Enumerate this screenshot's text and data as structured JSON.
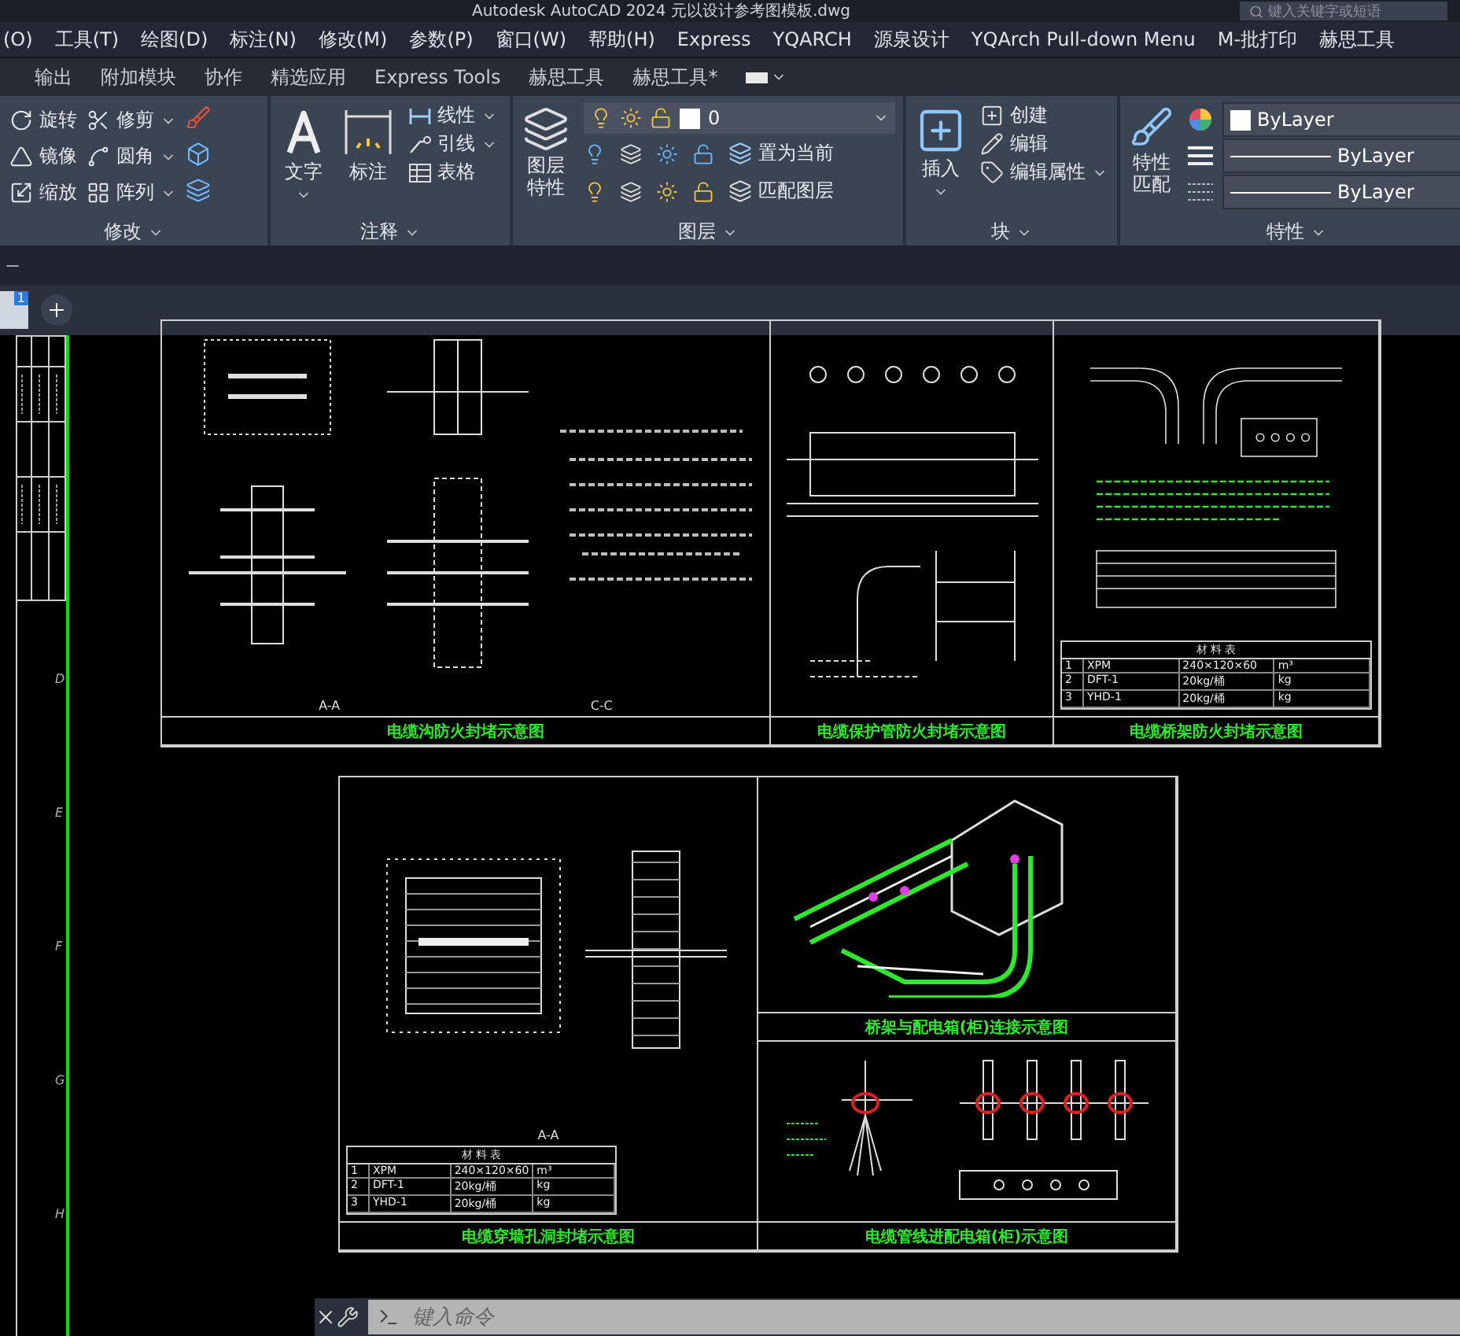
{
  "title_bar": {
    "title": "Autodesk AutoCAD 2024    元以设计参考图模板.dwg",
    "search_placeholder": "键入关键字或短语"
  },
  "menu_bar": [
    "(O)",
    "工具(T)",
    "绘图(D)",
    "标注(N)",
    "修改(M)",
    "参数(P)",
    "窗口(W)",
    "帮助(H)",
    "Express",
    "YQARCH",
    "源泉设计",
    "YQArch Pull-down Menu",
    "M-批打印",
    "赫思工具"
  ],
  "ribbon_tabs": [
    "输出",
    "附加模块",
    "协作",
    "精选应用",
    "Express Tools",
    "赫思工具",
    "赫思工具*"
  ],
  "ribbon_panels": [
    {
      "kind": "modify",
      "title": "修改",
      "tools": [
        {
          "label": "旋转",
          "dropdown": false
        },
        {
          "label": "修剪",
          "dropdown": true
        },
        {
          "label": "镜像",
          "dropdown": false
        },
        {
          "label": "圆角",
          "dropdown": true
        },
        {
          "label": "缩放",
          "dropdown": false
        },
        {
          "label": "阵列",
          "dropdown": true
        }
      ]
    },
    {
      "kind": "annotation",
      "title": "注释",
      "big_tools": [
        {
          "label": "文字",
          "dropdown": true
        },
        {
          "label": "标注",
          "dropdown": false
        }
      ],
      "tools": [
        {
          "label": "线性",
          "dropdown": true
        },
        {
          "label": "引线",
          "dropdown": true
        },
        {
          "label": "表格",
          "dropdown": false
        }
      ]
    },
    {
      "kind": "layers",
      "title": "图层",
      "big_tools": [
        {
          "label": "图层特性",
          "dropdown": false
        }
      ],
      "layer": "0",
      "tools": [
        {
          "label": "置为当前",
          "dropdown": false
        },
        {
          "label": "匹配图层",
          "dropdown": false
        }
      ]
    },
    {
      "kind": "block",
      "title": "块",
      "big_tools": [
        {
          "label": "插入",
          "dropdown": true
        }
      ],
      "tools": [
        {
          "label": "创建",
          "dropdown": false
        },
        {
          "label": "编辑",
          "dropdown": false
        },
        {
          "label": "编辑属性",
          "dropdown": true
        }
      ]
    },
    {
      "kind": "properties",
      "title": "特性",
      "big_tools": [
        {
          "label": "特性匹配",
          "dropdown": false
        }
      ],
      "rows": [
        {
          "kind": "color",
          "value": "ByLayer"
        },
        {
          "kind": "linetype",
          "value": "ByLayer"
        },
        {
          "kind": "lineweight",
          "value": "ByLayer"
        }
      ]
    }
  ],
  "document_tabs": [
    {
      "badge": "1",
      "selected": true
    }
  ],
  "grid_labels": [
    "D",
    "E",
    "F",
    "G",
    "H"
  ],
  "sheets": [
    {
      "cells": [
        {
          "kind": "trench",
          "title": "电缆沟防火封堵示意图",
          "labels": [
            "A-A",
            "C-C"
          ]
        },
        {
          "kind": "conduit",
          "title": "电缆保护管防火封堵示意图"
        },
        {
          "kind": "tray",
          "title": "电缆桥架防火封堵示意图"
        }
      ],
      "table": {
        "title": "材 料 表",
        "rows": [
          [
            "1",
            "XPM",
            "240×120×60",
            "m³"
          ],
          [
            "2",
            "DFT-1",
            "20kg/桶",
            "kg"
          ],
          [
            "3",
            "YHD-1",
            "20kg/桶",
            "kg"
          ]
        ]
      }
    },
    {
      "cells": [
        {
          "kind": "wall",
          "title": "电缆穿墙孔洞封堵示意图",
          "labels": [
            "A-A"
          ]
        },
        {
          "kind": "cabinet",
          "title": "桥架与配电箱(柜)连接示意图"
        },
        {
          "kind": "pipes",
          "title": "电缆管线进配电箱(柜)示意图"
        }
      ],
      "table": {
        "title": "材 料 表",
        "rows": [
          [
            "1",
            "XPM",
            "240×120×60",
            "m³"
          ],
          [
            "2",
            "DFT-1",
            "20kg/桶",
            "kg"
          ],
          [
            "3",
            "YHD-1",
            "20kg/桶",
            "kg"
          ]
        ]
      }
    }
  ],
  "command_line": {
    "placeholder": "键入命令"
  }
}
